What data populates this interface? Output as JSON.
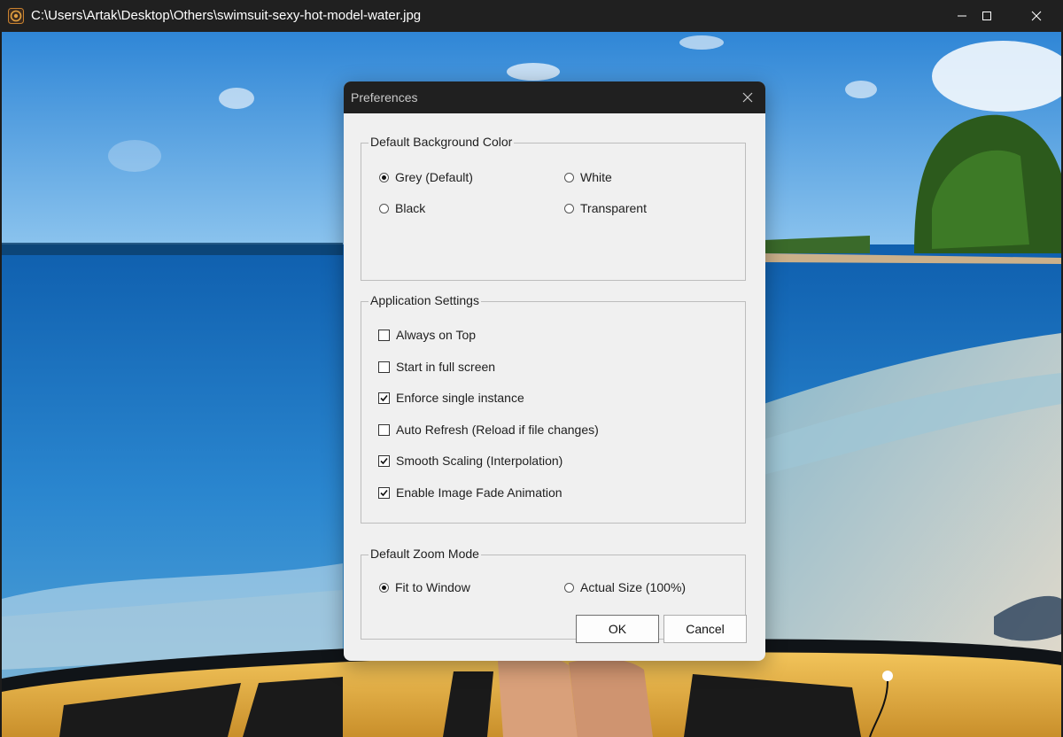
{
  "window": {
    "title": "C:\\Users\\Artak\\Desktop\\Others\\swimsuit-sexy-hot-model-water.jpg",
    "app_icon": "camera-aperture-icon",
    "controls": [
      "minimize-icon",
      "maximize-icon",
      "close-icon"
    ]
  },
  "dialog": {
    "title": "Preferences",
    "close_icon": "close-icon",
    "background_group": {
      "legend": "Default Background Color",
      "options": [
        {
          "label": "Grey (Default)",
          "selected": true
        },
        {
          "label": "White",
          "selected": false
        },
        {
          "label": "Black",
          "selected": false
        },
        {
          "label": "Transparent",
          "selected": false
        }
      ]
    },
    "app_settings_group": {
      "legend": "Application Settings",
      "options": [
        {
          "label": "Always on Top",
          "checked": false
        },
        {
          "label": "Start in full screen",
          "checked": false
        },
        {
          "label": "Enforce single instance",
          "checked": true
        },
        {
          "label": "Auto Refresh (Reload if file changes)",
          "checked": false
        },
        {
          "label": "Smooth Scaling (Interpolation)",
          "checked": true
        },
        {
          "label": "Enable Image Fade Animation",
          "checked": true
        }
      ]
    },
    "zoom_group": {
      "legend": "Default Zoom Mode",
      "options": [
        {
          "label": "Fit to Window",
          "selected": true
        },
        {
          "label": "Actual Size (100%)",
          "selected": false
        }
      ]
    },
    "buttons": {
      "ok": "OK",
      "cancel": "Cancel"
    }
  },
  "colors": {
    "titlebar": "#202020",
    "dialog_bg": "#f0f0f0",
    "sky": "#4a9be0",
    "sea": "#1f78c8",
    "board": "#e8b84a"
  }
}
